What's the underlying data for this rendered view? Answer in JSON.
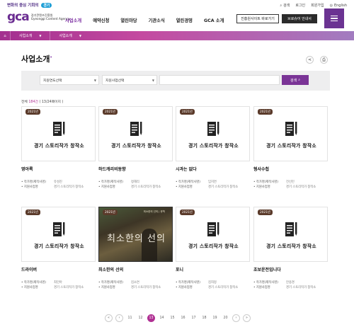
{
  "header": {
    "slogan": "변화의 중심 기회의",
    "slogan_badge": "경기",
    "logo_mark": "gca",
    "logo_text_1": "경기콘텐츠진흥원",
    "logo_text_2": "Gyeonggi Content Agency",
    "util": {
      "search": "검색",
      "login": "로그인",
      "join": "회원가입",
      "lang": "English"
    },
    "nav": [
      "사업소개",
      "예약신청",
      "열린마당",
      "기관소식",
      "열린경영",
      "GCA 소개"
    ],
    "btn_site": "진흥원사이트 바로가기",
    "btn_vr": "브로슈어 안내서"
  },
  "breadcrumb": [
    "사업소개",
    "사업소개"
  ],
  "page_title": "사업소개",
  "search": {
    "select1": "지원연도선택",
    "select2": "지원사업선택",
    "button": "검색"
  },
  "count": {
    "prefix": "전체",
    "total": "184건",
    "pages": "( 13/24페이지 )"
  },
  "placeholder_text": "경기 스토리작가 창작소",
  "meta_labels": {
    "writer": "작가명(제작사명)",
    "program": "지원사업명"
  },
  "cards": [
    {
      "year": "2021년",
      "title": "영아록",
      "writer": "유성진",
      "program": "경기 스토리작가 창작소"
    },
    {
      "year": "2021년",
      "title": "하드캐리비동향",
      "writer": "정해리",
      "program": "경기 스토리작가 창작소"
    },
    {
      "year": "2021년",
      "title": "시과는 없다",
      "writer": "임지연",
      "program": "경기 스토리작가 창작소"
    },
    {
      "year": "2021년",
      "title": "형사수첩",
      "writer": "전신민",
      "program": "경기 스토리작가 창작소"
    },
    {
      "year": "2021년",
      "title": "드라이버",
      "writer": "최민아",
      "program": "경기 스토리작가 창작소"
    },
    {
      "year": "2021년",
      "title": "최소한의 선의",
      "writer": "김소연",
      "program": "경기 스토리작가 창작소",
      "photo_title": "최소한의 선의",
      "photo_top": "최소한의 선의 | 문학"
    },
    {
      "year": "2021년",
      "title": "포니",
      "writer": "김희정",
      "program": "경기 스토리작가 창작소"
    },
    {
      "year": "2021년",
      "title": "초보운전입니다",
      "writer": "안용경",
      "program": "경기 스토리작가 창작소"
    }
  ],
  "pagination": {
    "first": "«",
    "prev": "‹",
    "next": "›",
    "last": "»",
    "pages": [
      "11",
      "12",
      "13",
      "14",
      "15",
      "16",
      "17",
      "18",
      "19",
      "20"
    ],
    "current": "13"
  }
}
